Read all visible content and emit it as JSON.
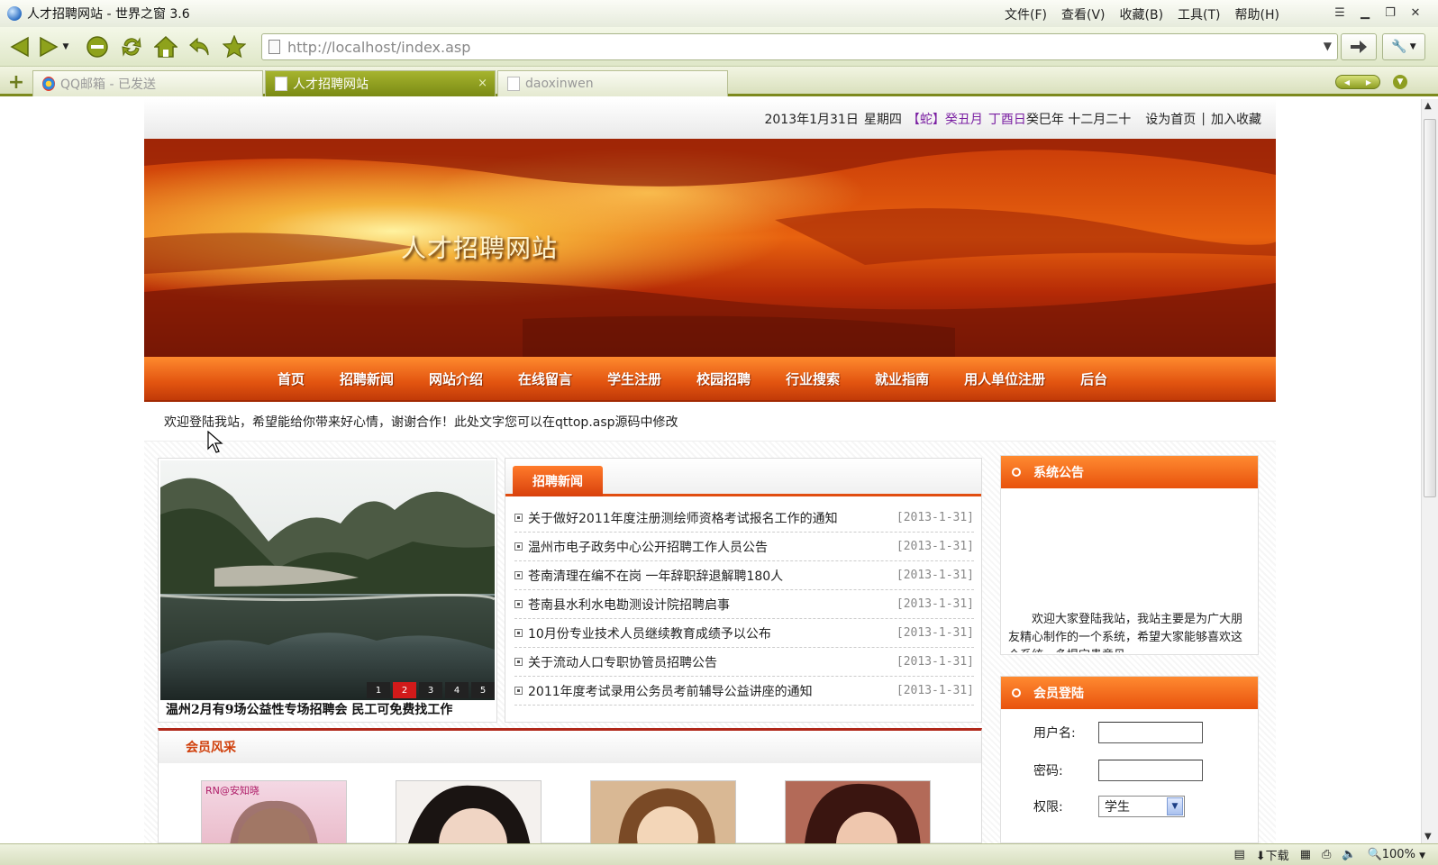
{
  "window": {
    "title": "人才招聘网站 - 世界之窗 3.6"
  },
  "menubar": [
    "文件(F)",
    "查看(V)",
    "收藏(B)",
    "工具(T)",
    "帮助(H)"
  ],
  "address": {
    "url": "http://localhost/index.asp"
  },
  "tabs": [
    {
      "label": "QQ邮箱 - 已发送",
      "active": false
    },
    {
      "label": "人才招聘网站",
      "active": true
    },
    {
      "label": "daoxinwen",
      "active": false
    }
  ],
  "topinfo": {
    "date": "2013年1月31日",
    "weekday": "星期四",
    "lunar_zodiac": "【蛇】",
    "lunar_month": "癸丑月",
    "lunar_day": "丁酉日",
    "lunar_year": "癸巳年 十二月二十",
    "set_home": "设为首页",
    "separator": "|",
    "add_fav": "加入收藏"
  },
  "site": {
    "title": "人才招聘网站"
  },
  "nav": [
    "首页",
    "招聘新闻",
    "网站介绍",
    "在线留言",
    "学生注册",
    "校园招聘",
    "行业搜索",
    "就业指南",
    "用人单位注册",
    "后台"
  ],
  "marquee": "欢迎登陆我站，希望能给你带来好心情，谢谢合作！此处文字您可以在qttop.asp源码中修改",
  "slider": {
    "numbers": [
      "1",
      "2",
      "3",
      "4",
      "5"
    ],
    "active": 2,
    "caption": "温州2月有9场公益性专场招聘会 民工可免费找工作"
  },
  "news": {
    "title": "招聘新闻",
    "items": [
      {
        "title": "关于做好2011年度注册测绘师资格考试报名工作的通知",
        "date": "[2013-1-31]"
      },
      {
        "title": "温州市电子政务中心公开招聘工作人员公告",
        "date": "[2013-1-31]"
      },
      {
        "title": "苍南清理在编不在岗 一年辞职辞退解聘180人",
        "date": "[2013-1-31]"
      },
      {
        "title": "苍南县水利水电勘测设计院招聘启事",
        "date": "[2013-1-31]"
      },
      {
        "title": "10月份专业技术人员继续教育成绩予以公布",
        "date": "[2013-1-31]"
      },
      {
        "title": "关于流动人口专职协管员招聘公告",
        "date": "[2013-1-31]"
      },
      {
        "title": "2011年度考试录用公务员考前辅导公益讲座的通知",
        "date": "[2013-1-31]"
      }
    ]
  },
  "notice": {
    "title": "系统公告",
    "text": "欢迎大家登陆我站，我站主要是为广大朋友精心制作的一个系统，希望大家能够喜欢这个系统，多提宝贵意见。"
  },
  "login": {
    "title": "会员登陆",
    "user_label": "用户名:",
    "pass_label": "密码:",
    "role_label": "权限:",
    "role_value": "学生"
  },
  "members": {
    "title": "会员风采",
    "badge": "RN@安知晓"
  },
  "statusbar": {
    "download": "下载",
    "zoom": "100%"
  },
  "colors": {
    "accent": "#e8520d",
    "nav_top": "#ff8a2e",
    "nav_bottom": "#c13a08",
    "chrome": "#dfe7c8"
  }
}
